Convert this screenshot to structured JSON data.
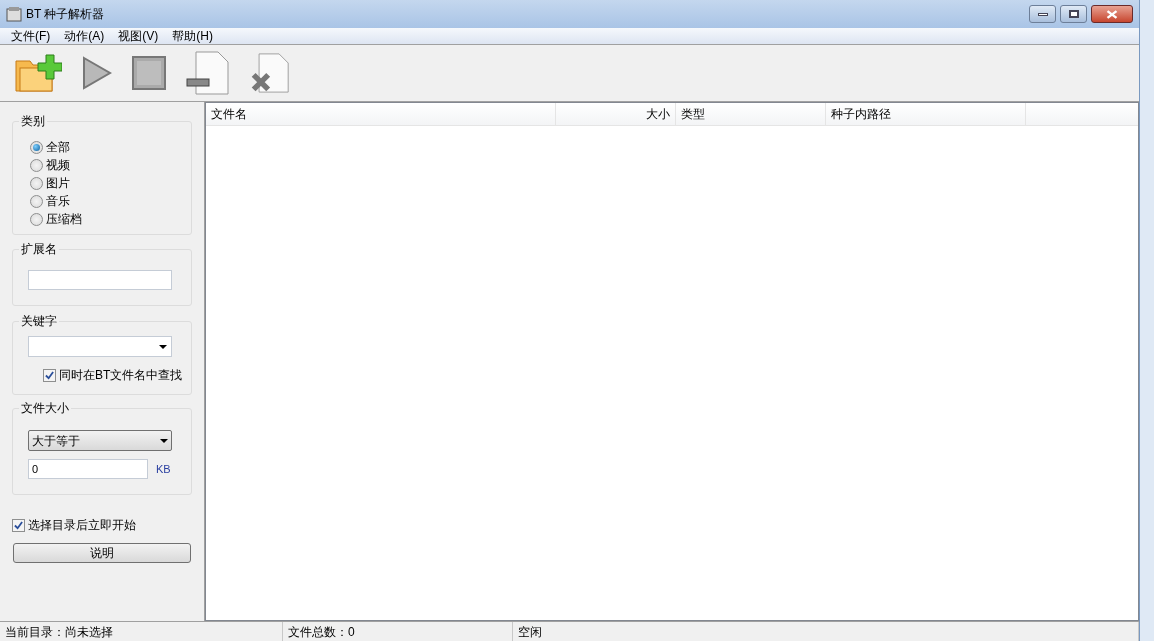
{
  "window": {
    "title": "BT 种子解析器"
  },
  "menu": [
    "文件(F)",
    "动作(A)",
    "视图(V)",
    "帮助(H)"
  ],
  "category": {
    "title": "类别",
    "options": [
      {
        "label": "全部",
        "selected": true
      },
      {
        "label": "视频",
        "selected": false
      },
      {
        "label": "图片",
        "selected": false
      },
      {
        "label": "音乐",
        "selected": false
      },
      {
        "label": "压缩档",
        "selected": false
      }
    ]
  },
  "extension": {
    "title": "扩展名"
  },
  "keyword": {
    "title": "关键字",
    "also_search": {
      "label": "同时在BT文件名中查找",
      "checked": true
    }
  },
  "file_size": {
    "title": "文件大小",
    "operator": "大于等于",
    "value": "0",
    "unit": "KB"
  },
  "start_after_select": {
    "label": "选择目录后立即开始",
    "checked": true
  },
  "help_button": "说明",
  "table": {
    "columns": [
      {
        "label": "文件名",
        "right_aligned": false
      },
      {
        "label": "大小",
        "right_aligned": true
      },
      {
        "label": "类型",
        "right_aligned": false
      },
      {
        "label": "种子内路径",
        "right_aligned": false
      }
    ]
  },
  "status_bar": [
    "当前目录：尚未选择",
    "文件总数：0",
    "空闲"
  ]
}
